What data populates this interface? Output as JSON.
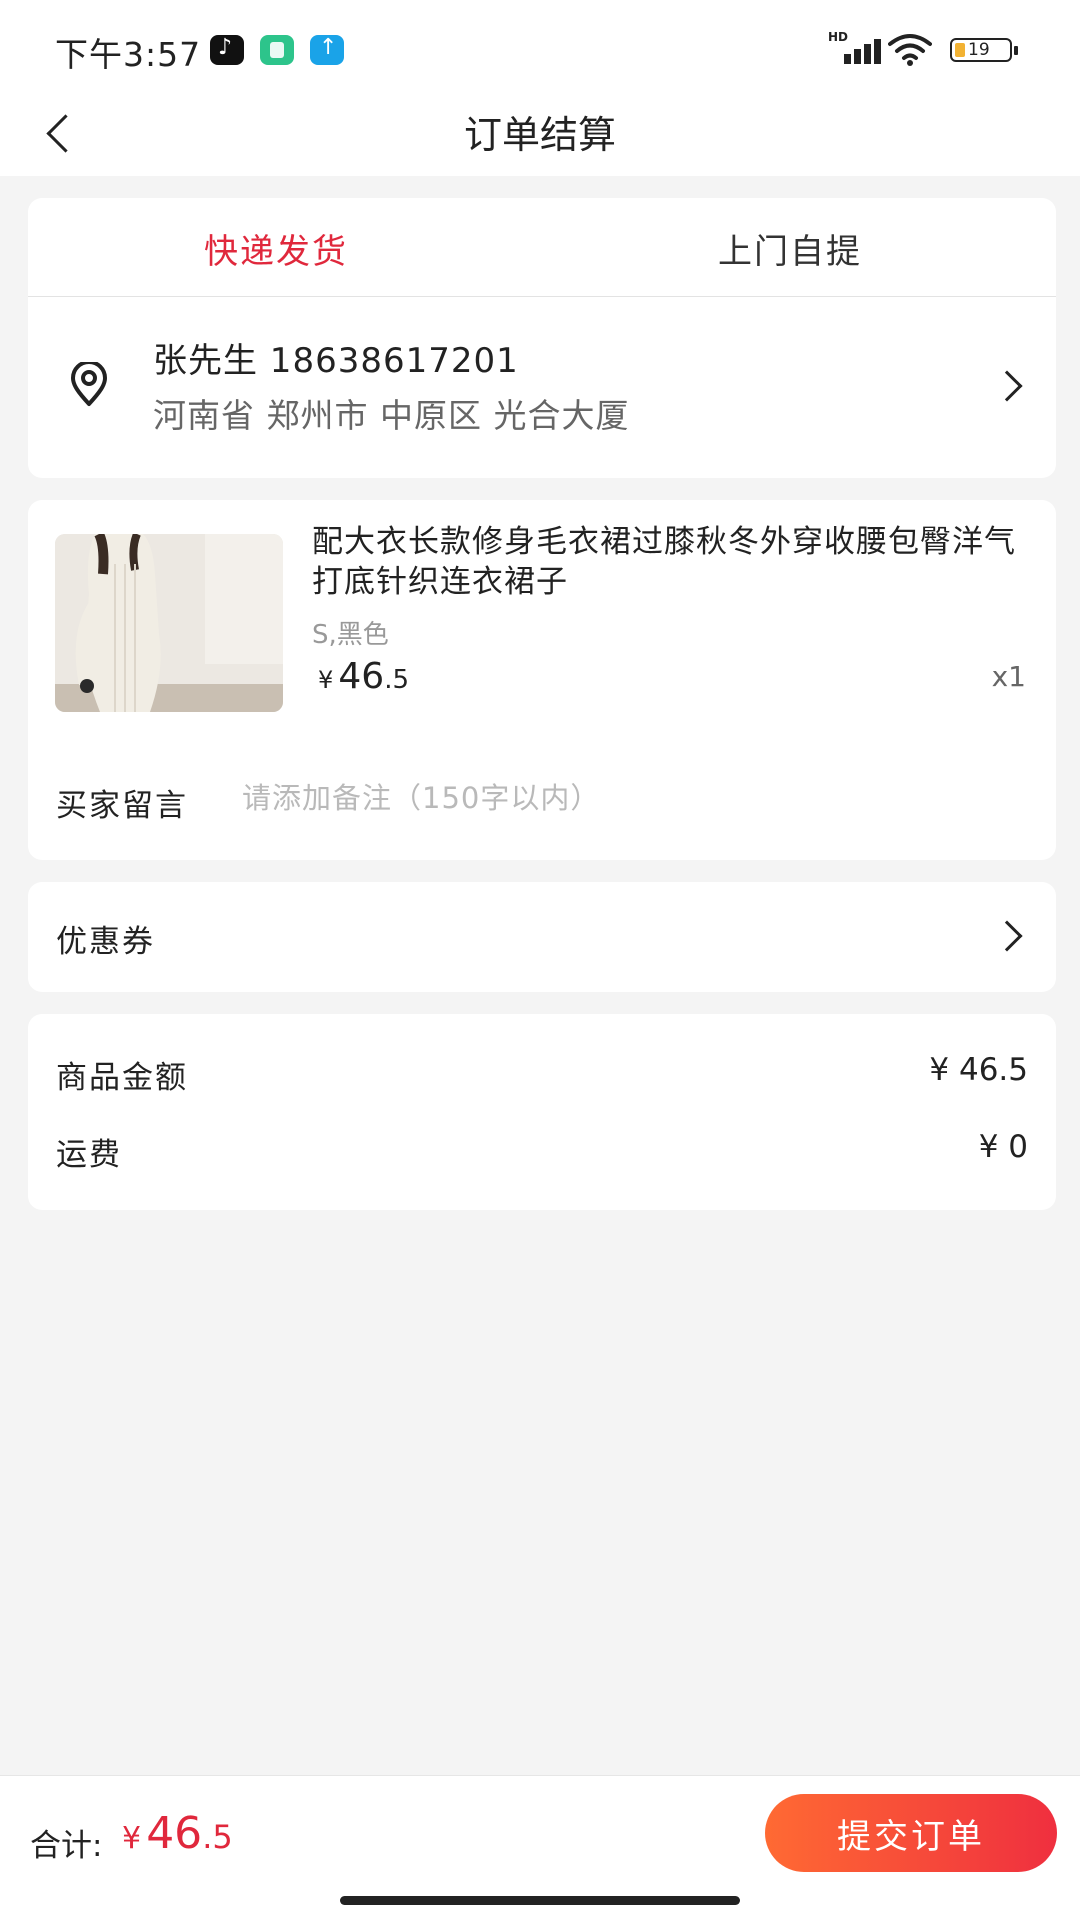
{
  "status_bar": {
    "time": "下午3:57",
    "battery": "19",
    "network": "HD"
  },
  "nav": {
    "title": "订单结算"
  },
  "delivery_tabs": [
    {
      "label": "快递发货",
      "active": true
    },
    {
      "label": "上门自提",
      "active": false
    }
  ],
  "address": {
    "name_phone": "张先生 18638617201",
    "detail": "河南省 郑州市 中原区 光合大厦"
  },
  "product": {
    "title": "配大衣长款修身毛衣裙过膝秋冬外穿收腰包臀洋气打底针织连衣裙子",
    "spec": "S,黑色",
    "price_currency": "¥",
    "price_int": "46",
    "price_dec": ".5",
    "qty": "x1"
  },
  "message": {
    "label": "买家留言",
    "placeholder": "请添加备注（150字以内）"
  },
  "coupon": {
    "label": "优惠券"
  },
  "summary": {
    "goods_label": "商品金额",
    "goods_value": "¥ 46.5",
    "shipping_label": "运费",
    "shipping_value": "¥ 0"
  },
  "bottom": {
    "total_label": "合计:",
    "total_currency": "¥",
    "total_int": "46",
    "total_dec": ".5",
    "submit_label": "提交订单"
  },
  "colors": {
    "accent": "#e0283c",
    "button_start": "#ff6a33",
    "button_end": "#ef2f3f"
  }
}
